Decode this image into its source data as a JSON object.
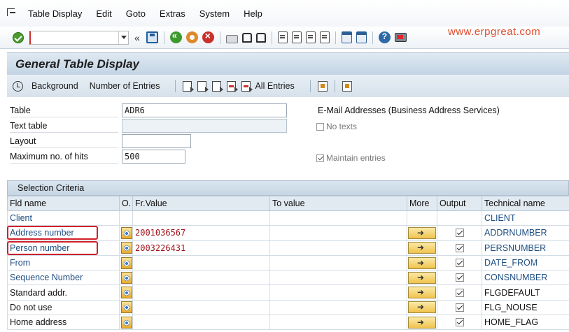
{
  "menu": [
    "Table Display",
    "Edit",
    "Goto",
    "Extras",
    "System",
    "Help"
  ],
  "toolbar": {
    "command_value": "",
    "nav_glyph": "«"
  },
  "watermark": "www.erpgreat.com",
  "title": "General Table Display",
  "app_toolbar": {
    "background": "Background",
    "num_entries": "Number of Entries",
    "all_entries": "All Entries"
  },
  "form": {
    "table_label": "Table",
    "table_value": "ADR6",
    "table_desc": "E-Mail Addresses (Business Address Services)",
    "text_table_label": "Text table",
    "no_texts_label": "No texts",
    "layout_label": "Layout",
    "max_hits_label": "Maximum no. of hits",
    "max_hits_value": "500",
    "maintain_label": "Maintain entries"
  },
  "grid": {
    "title": "Selection Criteria",
    "headers": {
      "fld": "Fld name",
      "o": "O.",
      "from": "Fr.Value",
      "to": "To value",
      "more": "More",
      "output": "Output",
      "tech": "Technical name"
    },
    "rows": [
      {
        "fld": "Client",
        "from": "",
        "tech": "CLIENT"
      },
      {
        "fld": "Address number",
        "from": "2001036567",
        "tech": "ADDRNUMBER"
      },
      {
        "fld": "Person number",
        "from": "2003226431",
        "tech": "PERSNUMBER"
      },
      {
        "fld": "From",
        "from": "",
        "tech": "DATE_FROM"
      },
      {
        "fld": "Sequence Number",
        "from": "",
        "tech": "CONSNUMBER"
      },
      {
        "fld": "Standard addr.",
        "from": "",
        "tech": "FLGDEFAULT"
      },
      {
        "fld": "Do not use",
        "from": "",
        "tech": "FLG_NOUSE"
      },
      {
        "fld": "Home address",
        "from": "",
        "tech": "HOME_FLAG"
      }
    ]
  }
}
